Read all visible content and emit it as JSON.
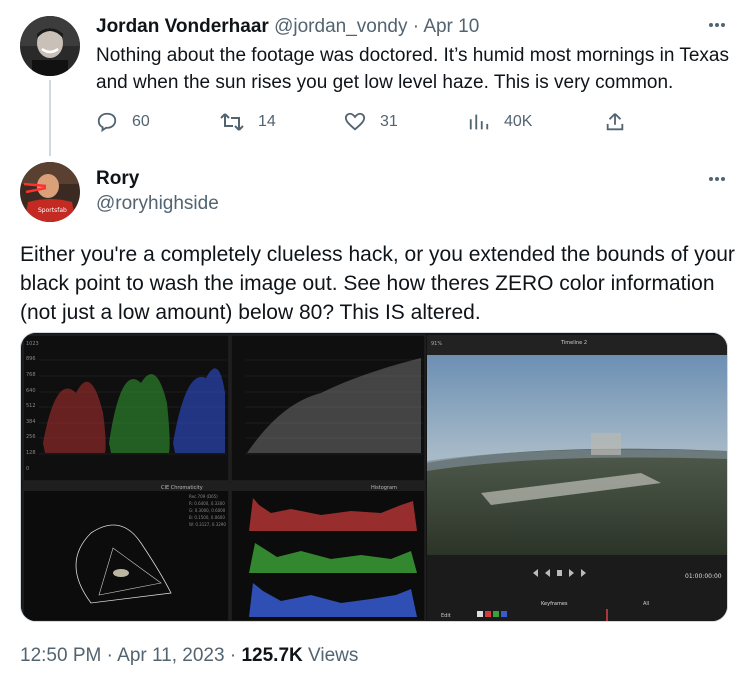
{
  "reply": {
    "name": "Jordan Vonderhaar",
    "handle": "@jordan_vondy",
    "separator": " · ",
    "date": "Apr 10",
    "more_icon": "more-horizontal-icon",
    "text": "Nothing about the footage was doctored. It’s humid most mornings in Texas and when the sun rises you get low level haze. This is very common.",
    "actions": {
      "replies": "60",
      "retweets": "14",
      "likes": "31",
      "views": "40K"
    }
  },
  "tweet": {
    "name": "Rory",
    "handle": "@roryhighside",
    "more_icon": "more-horizontal-icon",
    "text": "Either you're a completely clueless hack, or you extended the bounds of your black point to wash the image out. See how theres ZERO color information (not just a low amount) below 80? This IS altered.",
    "time": "12:50 PM",
    "date": "Apr 11, 2023",
    "views_count": "125.7K",
    "views_label": "Views",
    "footer_sep": " · "
  },
  "media": {
    "waveform_ticks": [
      "1023",
      "896",
      "768",
      "640",
      "512",
      "384",
      "256",
      "128",
      "0"
    ],
    "cie_title": "CIE Chromaticity",
    "histogram_title": "Histogram",
    "timeline_label": "Timeline 2",
    "timecode": "01:00:00:00",
    "keyframes_label": "Keyframes",
    "edit_label": "Edit",
    "zoom_label": "91%",
    "all_label": "All",
    "cie_legend": [
      "Rec.709 (D65)",
      "R: 0.6400, 0.3300",
      "G: 0.3000, 0.6000",
      "B: 0.1500, 0.0600",
      "W: 0.3127, 0.3290"
    ],
    "colors": {
      "red": "#d04040",
      "green": "#44b040",
      "blue": "#3a5ad8",
      "panel_bg": "#1a1a1a"
    }
  }
}
